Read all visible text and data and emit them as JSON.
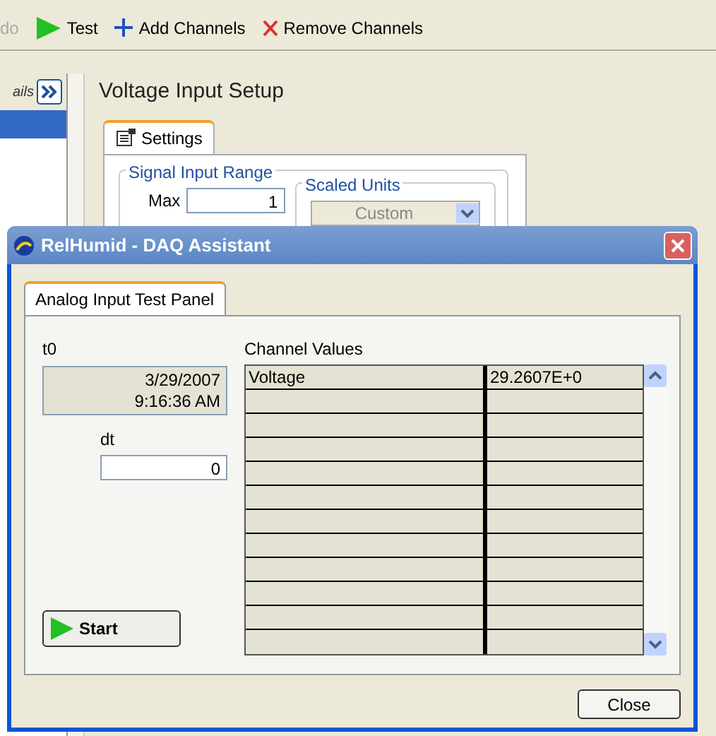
{
  "toolbar": {
    "items": [
      {
        "kind": "plain",
        "label": "do",
        "disabled": true
      },
      {
        "kind": "run",
        "label": "Test",
        "disabled": false
      },
      {
        "kind": "add",
        "label": "Add Channels",
        "disabled": false
      },
      {
        "kind": "remove",
        "label": "Remove Channels",
        "disabled": false
      }
    ]
  },
  "channel_panel": {
    "label": "ails"
  },
  "setup": {
    "title": "Voltage Input Setup",
    "tab": {
      "label": "Settings",
      "selected": true
    },
    "range_group": "Signal Input Range",
    "max_label": "Max",
    "max_value": "1",
    "units_group": "Scaled Units",
    "units_value": "Custom"
  },
  "dialog": {
    "title": "RelHumid - DAQ Assistant",
    "tab": {
      "label": "Analog Input Test Panel",
      "selected": true
    },
    "t0_label": "t0",
    "t0_value": [
      "3/29/2007",
      "9:16:36 AM"
    ],
    "dt_label": "dt",
    "dt_value": "0",
    "start_button": "Start",
    "channel_values_label": "Channel Values",
    "rows": [
      [
        "Voltage",
        "29.2607E+0"
      ]
    ],
    "close_button": "Close"
  }
}
